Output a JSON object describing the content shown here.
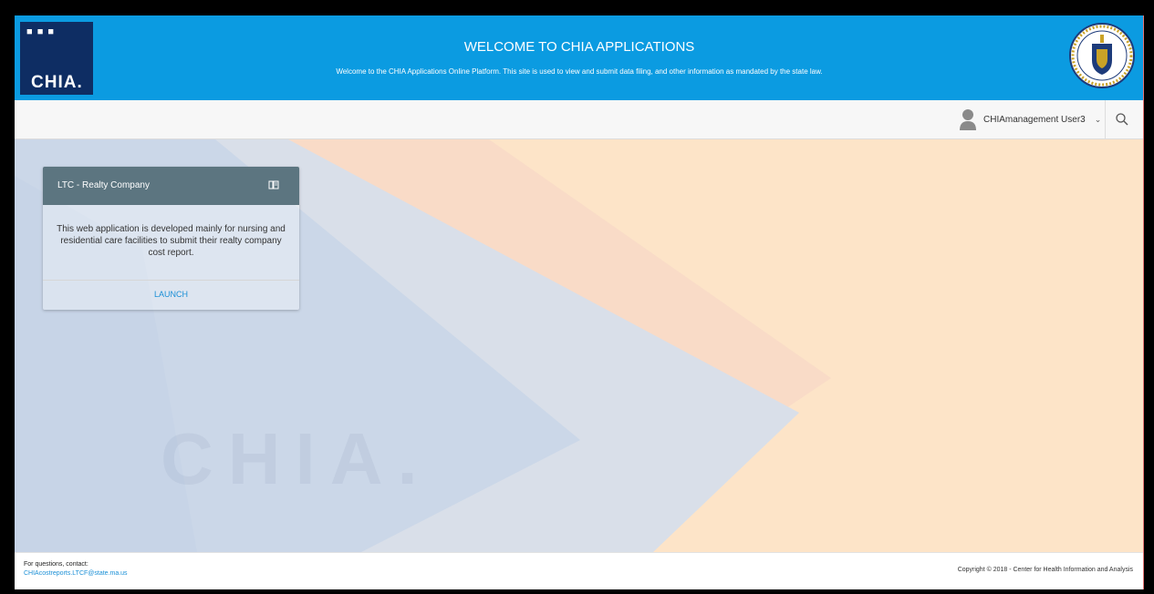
{
  "header": {
    "logo_text": "CHIA.",
    "title": "WELCOME TO CHIA APPLICATIONS",
    "subtitle": "Welcome to the CHIA Applications Online Platform. This site is used to view and submit data filing, and other information as mandated by the state law."
  },
  "toolbar": {
    "user_name": "CHIAmanagement User3",
    "user_chevron": "⌄"
  },
  "background": {
    "watermark": "CHIA."
  },
  "app_card": {
    "title": "LTC - Realty Company",
    "description": "This web application is developed mainly for nursing and residential care facilities to submit their realty company cost report.",
    "launch_label": "LAUNCH"
  },
  "footer": {
    "contact_label": "For questions, contact:",
    "contact_email": "CHIAcostreports.LTCF@state.ma.us",
    "copyright": "Copyright © 2018 - Center for Health Information and Analysis"
  },
  "colors": {
    "banner": "#0b9be1",
    "logo_bg": "#0e2d63",
    "card_header": "#5c7580",
    "link": "#1a8fd6"
  }
}
